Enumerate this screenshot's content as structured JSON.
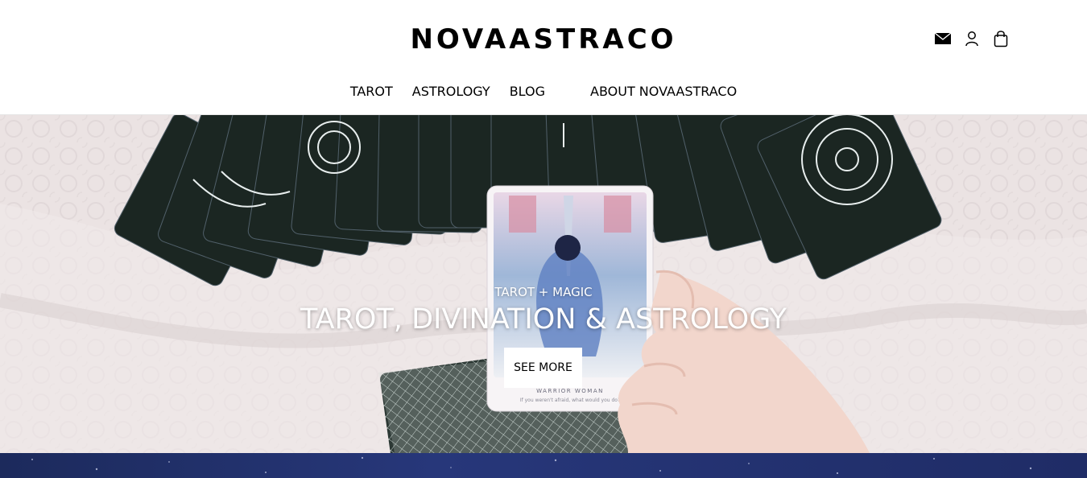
{
  "brand": {
    "name": "NOVAASTRACO"
  },
  "header": {
    "icons": [
      "mail-icon",
      "account-icon",
      "cart-icon"
    ]
  },
  "nav": {
    "items": [
      {
        "label": "TAROT"
      },
      {
        "label": "ASTROLOGY"
      },
      {
        "label": "BLOG"
      },
      {
        "label": "ABOUT NOVAASTRACO"
      }
    ]
  },
  "hero": {
    "subtitle": "TAROT + MAGIC",
    "title": "TAROT, DIVINATION & ASTROLOGY",
    "button_label": "SEE MORE",
    "card_caption": "WARRIOR WOMAN",
    "card_quote": "If you weren't afraid, what would you do?"
  },
  "colors": {
    "band": "#1f2c66",
    "card_back": "#1b2622",
    "cloth": "#ece4e4"
  }
}
